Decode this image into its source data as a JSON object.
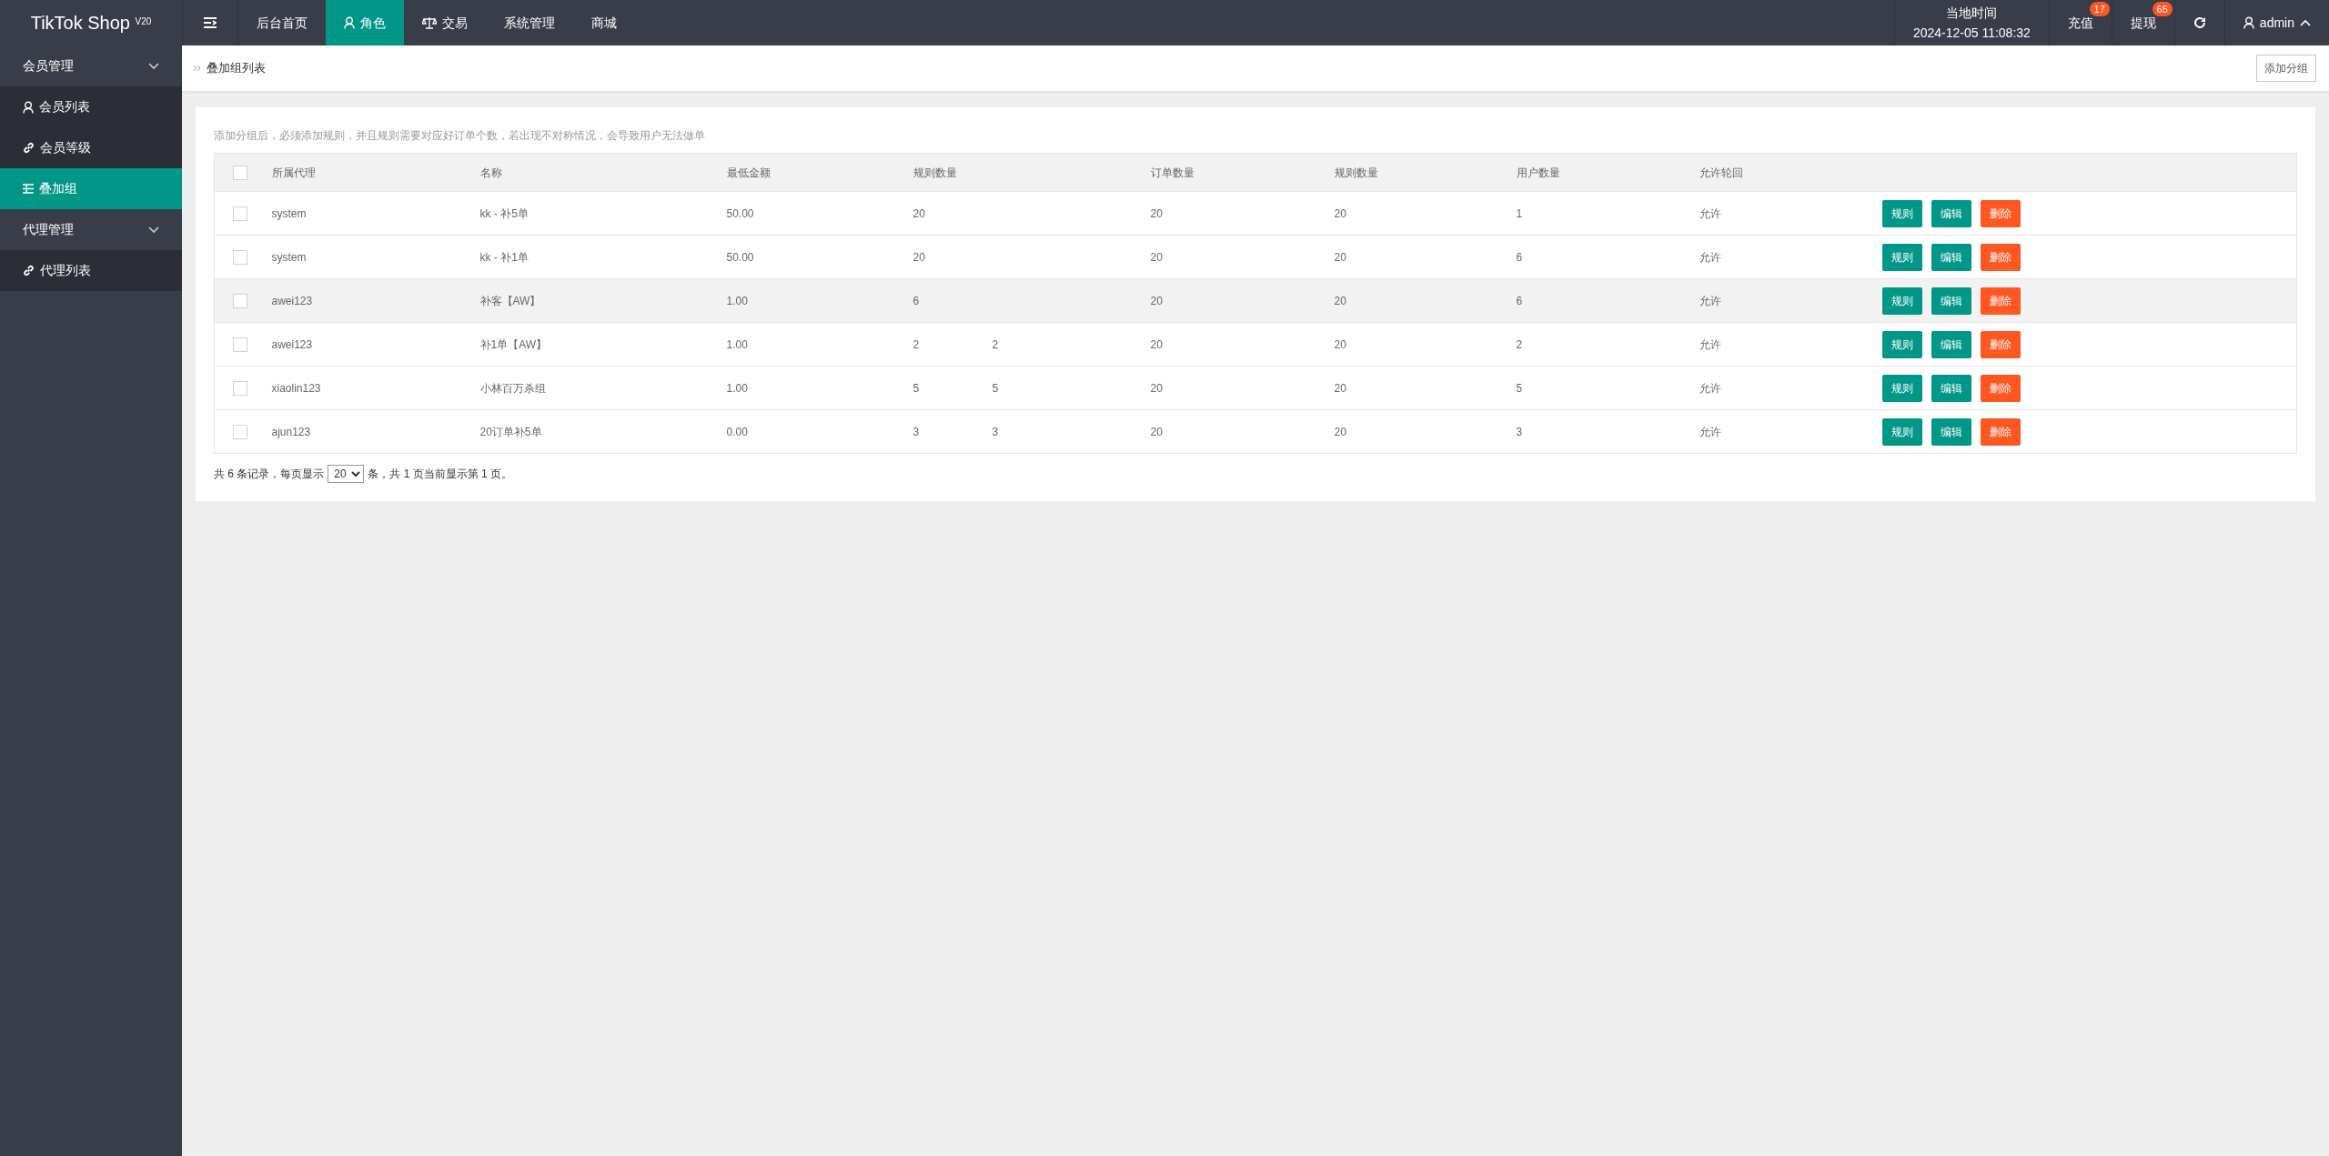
{
  "logo": {
    "name": "TikTok Shop",
    "version": "V20"
  },
  "nav": [
    {
      "label": "后台首页",
      "kind": "plain",
      "selected": false
    },
    {
      "label": "角色",
      "kind": "user",
      "selected": true
    },
    {
      "label": "交易",
      "kind": "scale",
      "selected": false
    },
    {
      "label": "系统管理",
      "kind": "plain",
      "selected": false
    },
    {
      "label": "商城",
      "kind": "plain",
      "selected": false
    }
  ],
  "clock": {
    "label": "当地时间",
    "value": "2024-12-05 11:08:32"
  },
  "header_actions": [
    {
      "label": "充值",
      "badge": "17"
    },
    {
      "label": "提现",
      "badge": "65"
    }
  ],
  "user": {
    "name": "admin"
  },
  "sidebar": [
    {
      "label": "会员管理",
      "expanded": true,
      "children": [
        {
          "label": "会员列表",
          "kind": "user",
          "selected": false
        },
        {
          "label": "会员等级",
          "kind": "link",
          "selected": false
        },
        {
          "label": "叠加组",
          "kind": "list",
          "selected": true
        }
      ]
    },
    {
      "label": "代理管理",
      "expanded": true,
      "children": [
        {
          "label": "代理列表",
          "kind": "link",
          "selected": false
        }
      ]
    }
  ],
  "breadcrumb": "叠加组列表",
  "add_button": "添加分组",
  "hint": "添加分组后，必须添加规则，并且规则需要对应好订单个数，若出现不对称情况，会导致用户无法做单",
  "table": {
    "all_checked": false,
    "columns": [
      {
        "label": "所属代理"
      },
      {
        "label": "名称"
      },
      {
        "label": "最低金额"
      },
      {
        "label": "规则数量"
      },
      {},
      {
        "label": "订单数量"
      },
      {
        "label": "规则数量"
      },
      {
        "label": "用户数量"
      },
      {
        "label": "允许轮回"
      }
    ],
    "rows": [
      {
        "checked": false,
        "highlighted": false,
        "cells": [
          "system",
          "kk - 补5单",
          "50.00",
          "20",
          null,
          "20",
          "20",
          "1",
          "允许"
        ],
        "actions": [
          {
            "label": "规则",
            "kind": "primary"
          },
          {
            "label": "编辑",
            "kind": "primary"
          },
          {
            "label": "删除",
            "kind": "danger"
          }
        ]
      },
      {
        "checked": false,
        "highlighted": false,
        "cells": [
          "system",
          "kk - 补1单",
          "50.00",
          "20",
          null,
          "20",
          "20",
          "6",
          "允许"
        ],
        "actions": [
          {
            "label": "规则",
            "kind": "primary"
          },
          {
            "label": "编辑",
            "kind": "primary"
          },
          {
            "label": "删除",
            "kind": "danger"
          }
        ]
      },
      {
        "checked": false,
        "highlighted": true,
        "cells": [
          "awei123",
          "补客【AW】",
          "1.00",
          "6",
          null,
          "20",
          "20",
          "6",
          "允许"
        ],
        "actions": [
          {
            "label": "规则",
            "kind": "primary"
          },
          {
            "label": "编辑",
            "kind": "primary"
          },
          {
            "label": "删除",
            "kind": "danger"
          }
        ]
      },
      {
        "checked": false,
        "highlighted": false,
        "cells": [
          "awei123",
          "补1单【AW】",
          "1.00",
          "2",
          "2",
          "20",
          "20",
          "2",
          "允许"
        ],
        "actions": [
          {
            "label": "规则",
            "kind": "primary"
          },
          {
            "label": "编辑",
            "kind": "primary"
          },
          {
            "label": "删除",
            "kind": "danger"
          }
        ]
      },
      {
        "checked": false,
        "highlighted": false,
        "cells": [
          "xiaolin123",
          "小林百万杀组",
          "1.00",
          "5",
          "5",
          "20",
          "20",
          "5",
          "允许"
        ],
        "actions": [
          {
            "label": "规则",
            "kind": "primary"
          },
          {
            "label": "编辑",
            "kind": "primary"
          },
          {
            "label": "删除",
            "kind": "danger"
          }
        ]
      },
      {
        "checked": false,
        "highlighted": false,
        "cells": [
          "ajun123",
          "20订单补5单",
          "0.00",
          "3",
          "3",
          "20",
          "20",
          "3",
          "允许"
        ],
        "actions": [
          {
            "label": "规则",
            "kind": "primary"
          },
          {
            "label": "编辑",
            "kind": "primary"
          },
          {
            "label": "删除",
            "kind": "danger"
          }
        ]
      }
    ]
  },
  "pagination": {
    "before": "共 6 条记录，每页显示",
    "page_size": "20",
    "after": "条，共 1 页当前显示第 1 页。"
  }
}
